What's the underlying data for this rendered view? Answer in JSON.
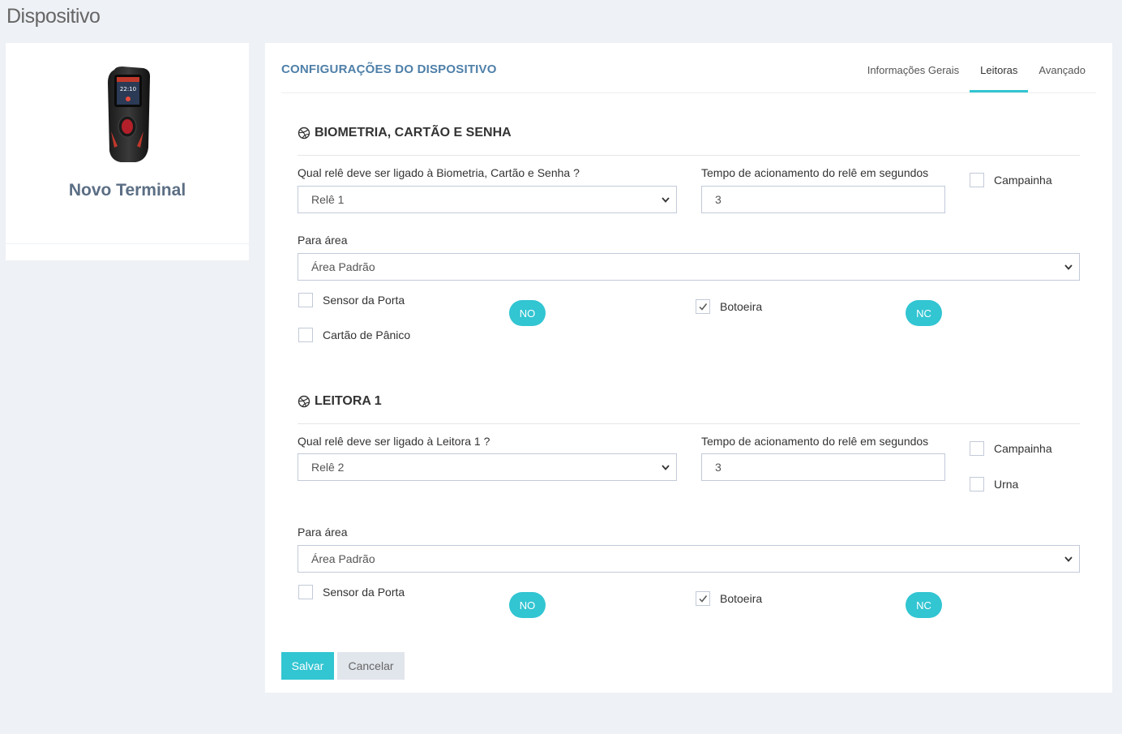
{
  "page": {
    "title": "Dispositivo"
  },
  "device": {
    "name": "Novo Terminal",
    "screen_time": "22:10"
  },
  "panel": {
    "title": "CONFIGURAÇÕES DO DISPOSITIVO",
    "tabs": [
      {
        "label": "Informações Gerais",
        "active": false
      },
      {
        "label": "Leitoras",
        "active": true
      },
      {
        "label": "Avançado",
        "active": false
      }
    ]
  },
  "sections": [
    {
      "title": "BIOMETRIA, CARTÃO E SENHA",
      "relay_label": "Qual relê deve ser ligado à Biometria, Cartão e Senha ?",
      "relay_value": "Relê 1",
      "time_label": "Tempo de acionamento do relê em segundos",
      "time_value": "3",
      "campainha_label": "Campainha",
      "campainha_checked": false,
      "area_label": "Para área",
      "area_value": "Área Padrão",
      "sensor_label": "Sensor da Porta",
      "sensor_checked": false,
      "sensor_mode": "NO",
      "botoeira_label": "Botoeira",
      "botoeira_checked": true,
      "botoeira_mode": "NC",
      "panico_label": "Cartão de Pânico",
      "panico_checked": false
    },
    {
      "title": "LEITORA 1",
      "relay_label": "Qual relê deve ser ligado à Leitora 1 ?",
      "relay_value": "Relê 2",
      "time_label": "Tempo de acionamento do relê em segundos",
      "time_value": "3",
      "campainha_label": "Campainha",
      "campainha_checked": false,
      "urna_label": "Urna",
      "urna_checked": false,
      "area_label": "Para área",
      "area_value": "Área Padrão",
      "sensor_label": "Sensor da Porta",
      "sensor_checked": false,
      "sensor_mode": "NO",
      "botoeira_label": "Botoeira",
      "botoeira_checked": true,
      "botoeira_mode": "NC"
    }
  ],
  "actions": {
    "save_label": "Salvar",
    "cancel_label": "Cancelar"
  },
  "colors": {
    "accent": "#32c5d2",
    "title_blue": "#4e7fa8",
    "background": "#eef1f5"
  }
}
